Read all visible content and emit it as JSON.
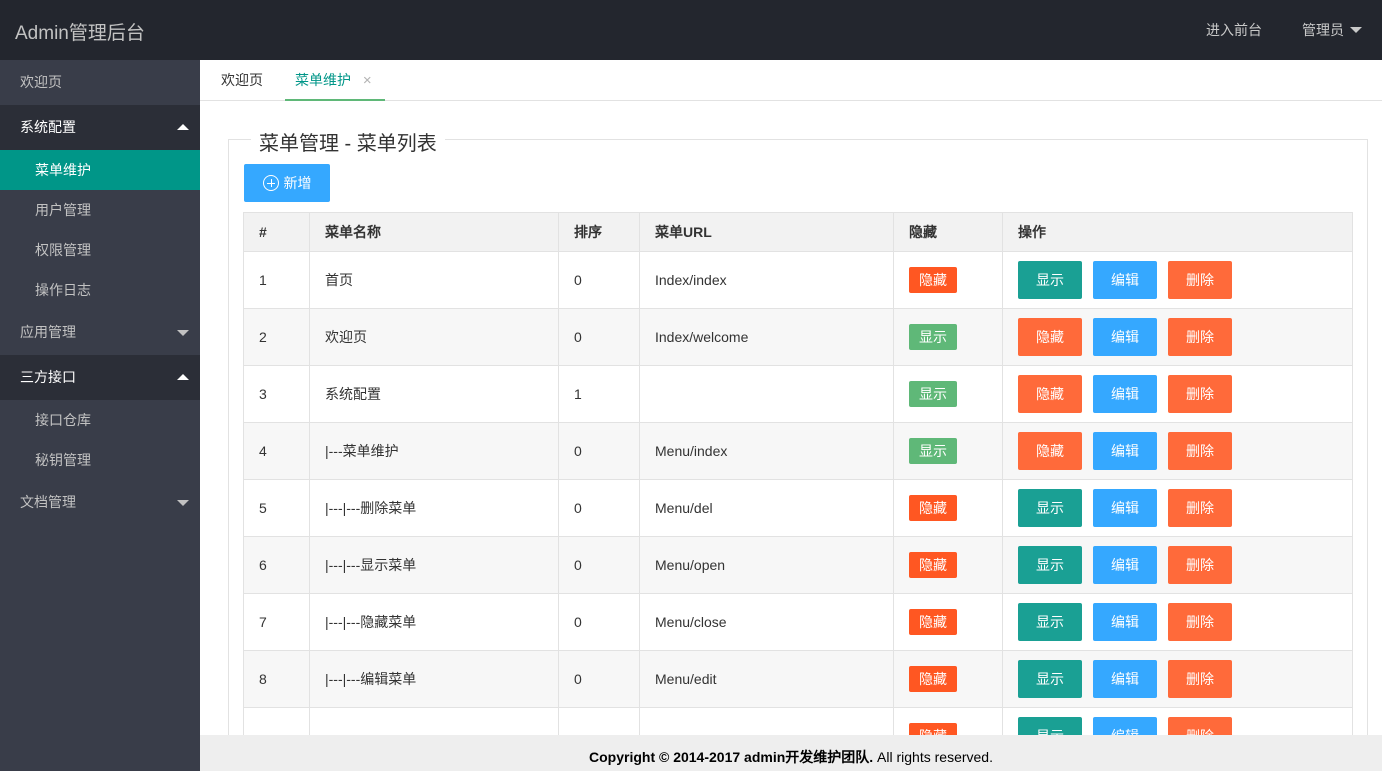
{
  "header": {
    "title": "Admin管理后台",
    "nav": [
      {
        "label": "进入前台"
      },
      {
        "label": "管理员",
        "icon": "caret-down-icon"
      }
    ]
  },
  "sidebar": {
    "items": [
      {
        "label": "欢迎页",
        "type": "item"
      },
      {
        "label": "系统配置",
        "type": "group",
        "expanded": true,
        "children": [
          {
            "label": "菜单维护",
            "active": true
          },
          {
            "label": "用户管理"
          },
          {
            "label": "权限管理"
          },
          {
            "label": "操作日志"
          }
        ]
      },
      {
        "label": "应用管理",
        "type": "group",
        "expanded": false
      },
      {
        "label": "三方接口",
        "type": "group",
        "expanded": true,
        "children": [
          {
            "label": "接口仓库"
          },
          {
            "label": "秘钥管理"
          }
        ]
      },
      {
        "label": "文档管理",
        "type": "group",
        "expanded": false
      }
    ]
  },
  "tabs": [
    {
      "label": "欢迎页"
    },
    {
      "label": "菜单维护",
      "active": true,
      "close": "×"
    }
  ],
  "panel": {
    "legend": "菜单管理 - 菜单列表",
    "add_label": "新增"
  },
  "table": {
    "columns": [
      "#",
      "菜单名称",
      "排序",
      "菜单URL",
      "隐藏",
      "操作"
    ],
    "rows": [
      {
        "id": "1",
        "name": "首页",
        "sort": "0",
        "url": "Index/index",
        "hidden": true
      },
      {
        "id": "2",
        "name": "欢迎页",
        "sort": "0",
        "url": "Index/welcome",
        "hidden": false
      },
      {
        "id": "3",
        "name": "系统配置",
        "sort": "1",
        "url": "",
        "hidden": false
      },
      {
        "id": "4",
        "name": "|---菜单维护",
        "sort": "0",
        "url": "Menu/index",
        "hidden": false
      },
      {
        "id": "5",
        "name": "|---|---删除菜单",
        "sort": "0",
        "url": "Menu/del",
        "hidden": true
      },
      {
        "id": "6",
        "name": "|---|---显示菜单",
        "sort": "0",
        "url": "Menu/open",
        "hidden": true
      },
      {
        "id": "7",
        "name": "|---|---隐藏菜单",
        "sort": "0",
        "url": "Menu/close",
        "hidden": true
      },
      {
        "id": "8",
        "name": "|---|---编辑菜单",
        "sort": "0",
        "url": "Menu/edit",
        "hidden": true
      },
      {
        "id": "",
        "name": "",
        "sort": "",
        "url": "",
        "hidden": true
      }
    ],
    "labels": {
      "hidden": "隐藏",
      "shown": "显示",
      "show_action": "显示",
      "hide_action": "隐藏",
      "edit_action": "编辑",
      "delete_action": "删除"
    }
  },
  "footer": {
    "bold": "Copyright © 2014-2017 admin开发维护团队.",
    "rest": " All rights reserved."
  },
  "colors": {
    "header_bg": "#23262e",
    "sidebar_bg": "#393d49",
    "active_green": "#009688",
    "tab_underline": "#5fb878",
    "btn_blue": "#35a8ff",
    "btn_orange": "#ff6a3a",
    "badge_red": "#ff5722",
    "badge_green": "#5fb878",
    "btn_teal": "#1aa094"
  }
}
